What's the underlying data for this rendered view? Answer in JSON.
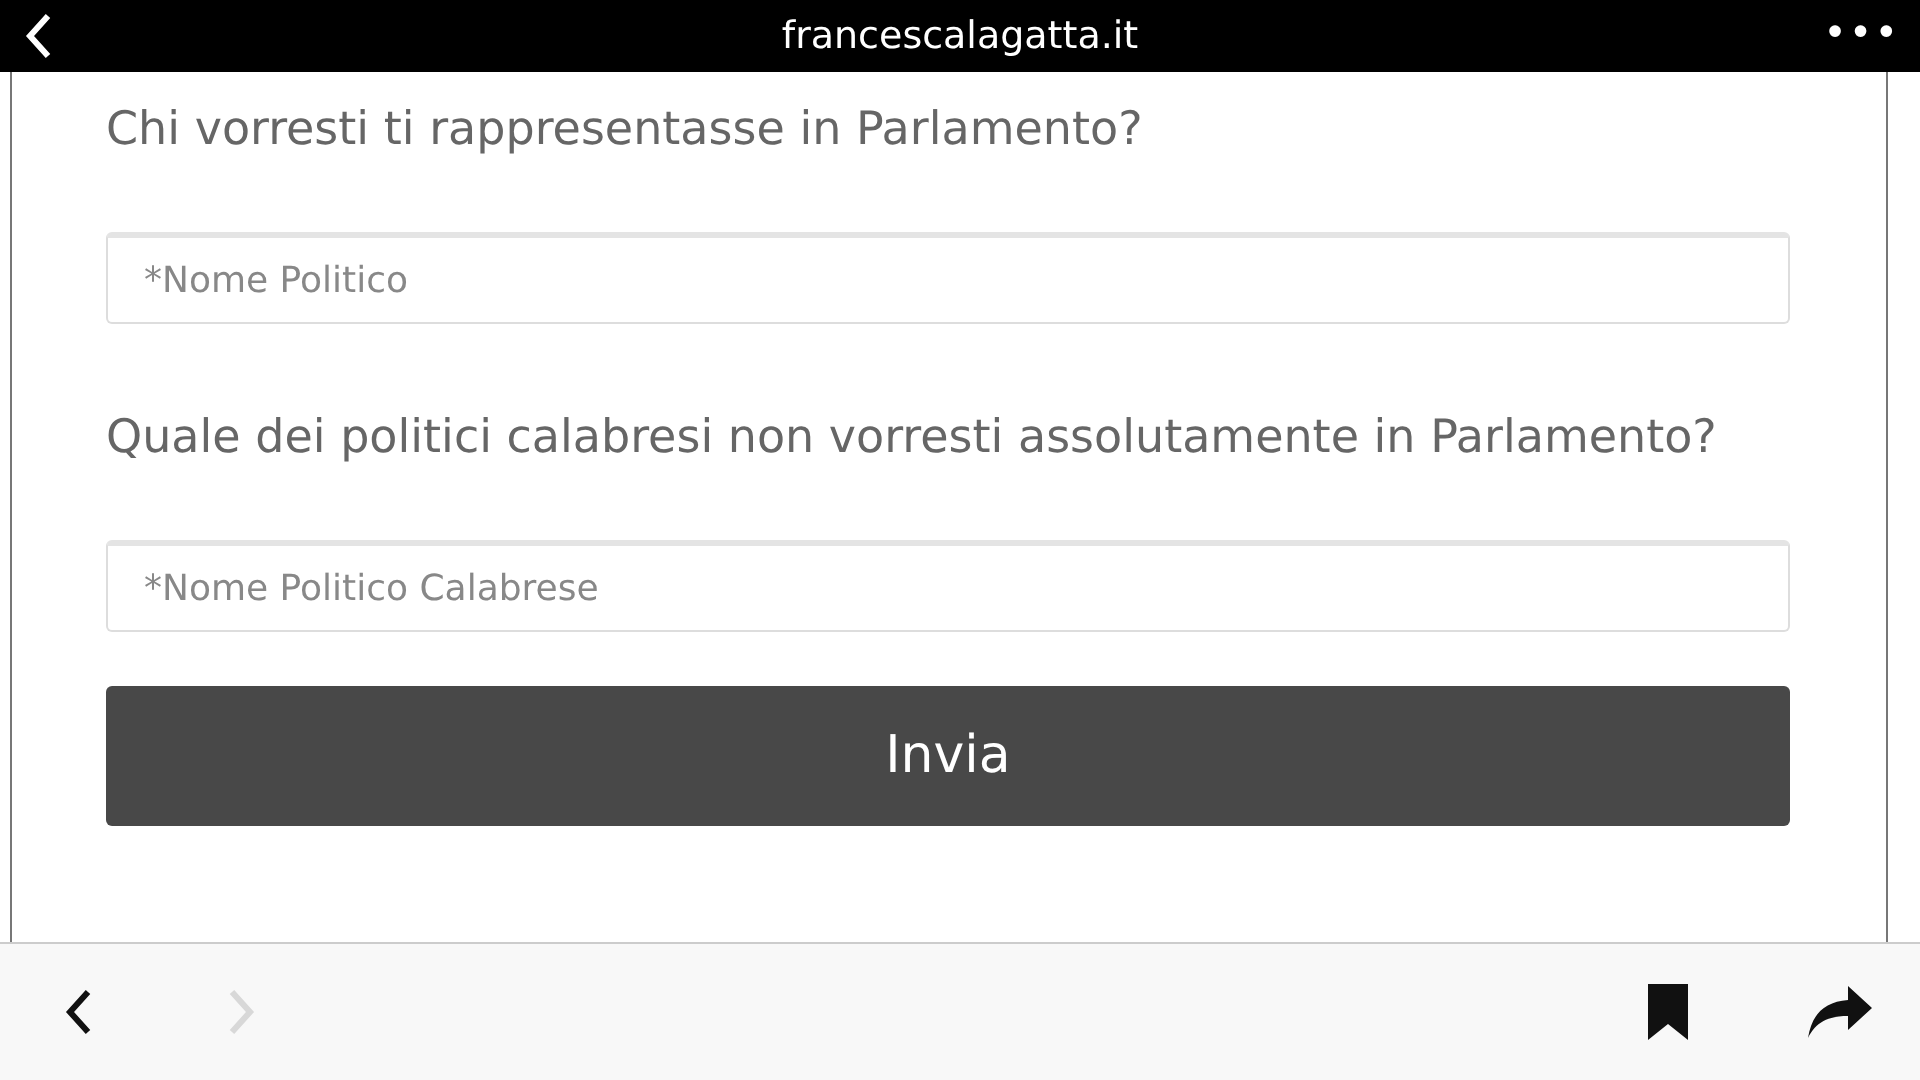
{
  "top_bar": {
    "url": "francescalagatta.it",
    "menu": "•••"
  },
  "form": [
    {
      "question": "Chi vorresti ti rappresentasse in Parlamento?",
      "placeholder": "*Nome Politico"
    },
    {
      "question": "Quale dei politici calabresi non vorresti assolutamente in Parlamento?",
      "placeholder": "*Nome Politico Calabrese"
    }
  ],
  "submit": "Invia",
  "toolbar": {
    "back_disabled": false,
    "forward_disabled": true
  }
}
